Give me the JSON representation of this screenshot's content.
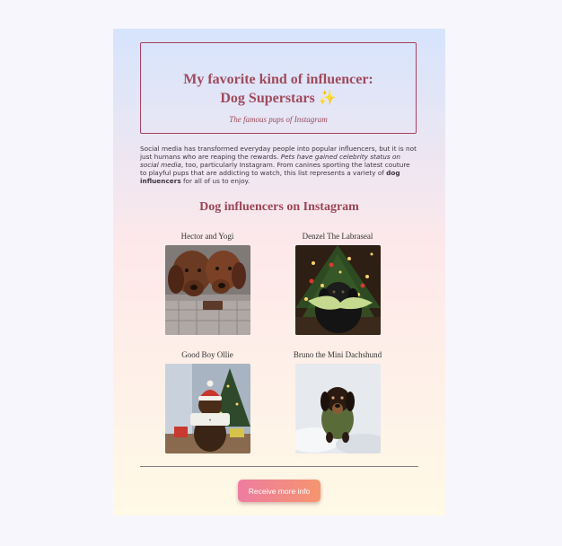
{
  "hero": {
    "title_line1": "My favorite kind of influencer:",
    "title_line2": "Dog Superstars",
    "sparkle": "✨",
    "subtitle": "The famous pups of Instagram"
  },
  "intro": {
    "part1": "Social media has transformed everyday people into popular influencers, but it is not just humans who are reaping the rewards. ",
    "italic": "Pets have gained celebrity status on social media",
    "part2": ", too, particularly Instagram. From canines sporting the latest couture to playful pups that are addicting to watch, this list represents a variety of ",
    "bold": "dog influencers",
    "part3": " for all of us to enjoy."
  },
  "section": {
    "title": "Dog influencers on Instagram"
  },
  "dogs": [
    {
      "name": "Hector and Yogi",
      "icon": "two-brown-dogs-photo"
    },
    {
      "name": "Denzel The Labraseal",
      "icon": "black-lab-christmas-photo"
    },
    {
      "name": "Good Boy Ollie",
      "icon": "dachshund-santa-hat-photo"
    },
    {
      "name": "Bruno the Mini Dachshund",
      "icon": "dachshund-snow-photo"
    }
  ],
  "cta": {
    "label": "Receive more info"
  },
  "colors": {
    "accent": "#a04a5c",
    "button_start": "#ee7ca0",
    "button_end": "#f6956f",
    "page_bg": "#f7f6fc"
  }
}
